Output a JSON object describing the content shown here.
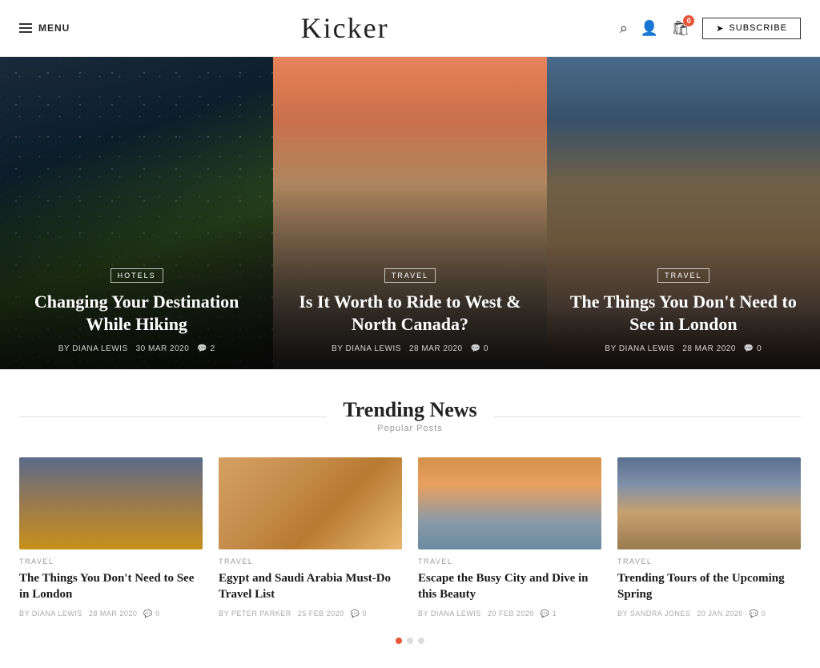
{
  "header": {
    "menu_label": "MENU",
    "logo": "Kicker",
    "subscribe_label": "SUBSCRIBE",
    "cart_count": "0",
    "icons": {
      "search": "🔍",
      "user": "👤",
      "cart": "🛍",
      "send": "✉"
    }
  },
  "hero": {
    "cards": [
      {
        "tag": "HOTELS",
        "title": "Changing Your Destination While Hiking",
        "author": "BY DIANA LEWIS",
        "date": "30 MAR 2020",
        "comments": "2",
        "bg_class": "card-bg-1"
      },
      {
        "tag": "TRAVEL",
        "title": "Is It Worth to Ride to West & North Canada?",
        "author": "BY DIANA LEWIS",
        "date": "28 MAR 2020",
        "comments": "0",
        "bg_class": "card-bg-2"
      },
      {
        "tag": "TRAVEL",
        "title": "The Things You Don't Need to See in London",
        "author": "BY DIANA LEWIS",
        "date": "28 MAR 2020",
        "comments": "0",
        "bg_class": "card-bg-3"
      }
    ]
  },
  "trending": {
    "title": "Trending News",
    "subtitle": "Popular Posts",
    "cards": [
      {
        "tag": "TRAVEL",
        "title": "The Things You Don't Need to See in London",
        "author": "BY DIANA LEWIS",
        "date": "28 MAR 2020",
        "comments": "0",
        "thumb_class": "thumb-1"
      },
      {
        "tag": "TRAVEL",
        "title": "Egypt and Saudi Arabia Must-Do Travel List",
        "author": "BY PETER PARKER",
        "date": "25 FEB 2020",
        "comments": "0",
        "thumb_class": "thumb-2"
      },
      {
        "tag": "TRAVEL",
        "title": "Escape the Busy City and Dive in this Beauty",
        "author": "BY DIANA LEWIS",
        "date": "20 FEB 2020",
        "comments": "1",
        "thumb_class": "thumb-3"
      },
      {
        "tag": "TRAVEL",
        "title": "Trending Tours of the Upcoming Spring",
        "author": "BY SANDRA JONES",
        "date": "20 JAN 2020",
        "comments": "0",
        "thumb_class": "thumb-4"
      }
    ],
    "dots": [
      {
        "active": true
      },
      {
        "active": false
      },
      {
        "active": false
      }
    ]
  }
}
